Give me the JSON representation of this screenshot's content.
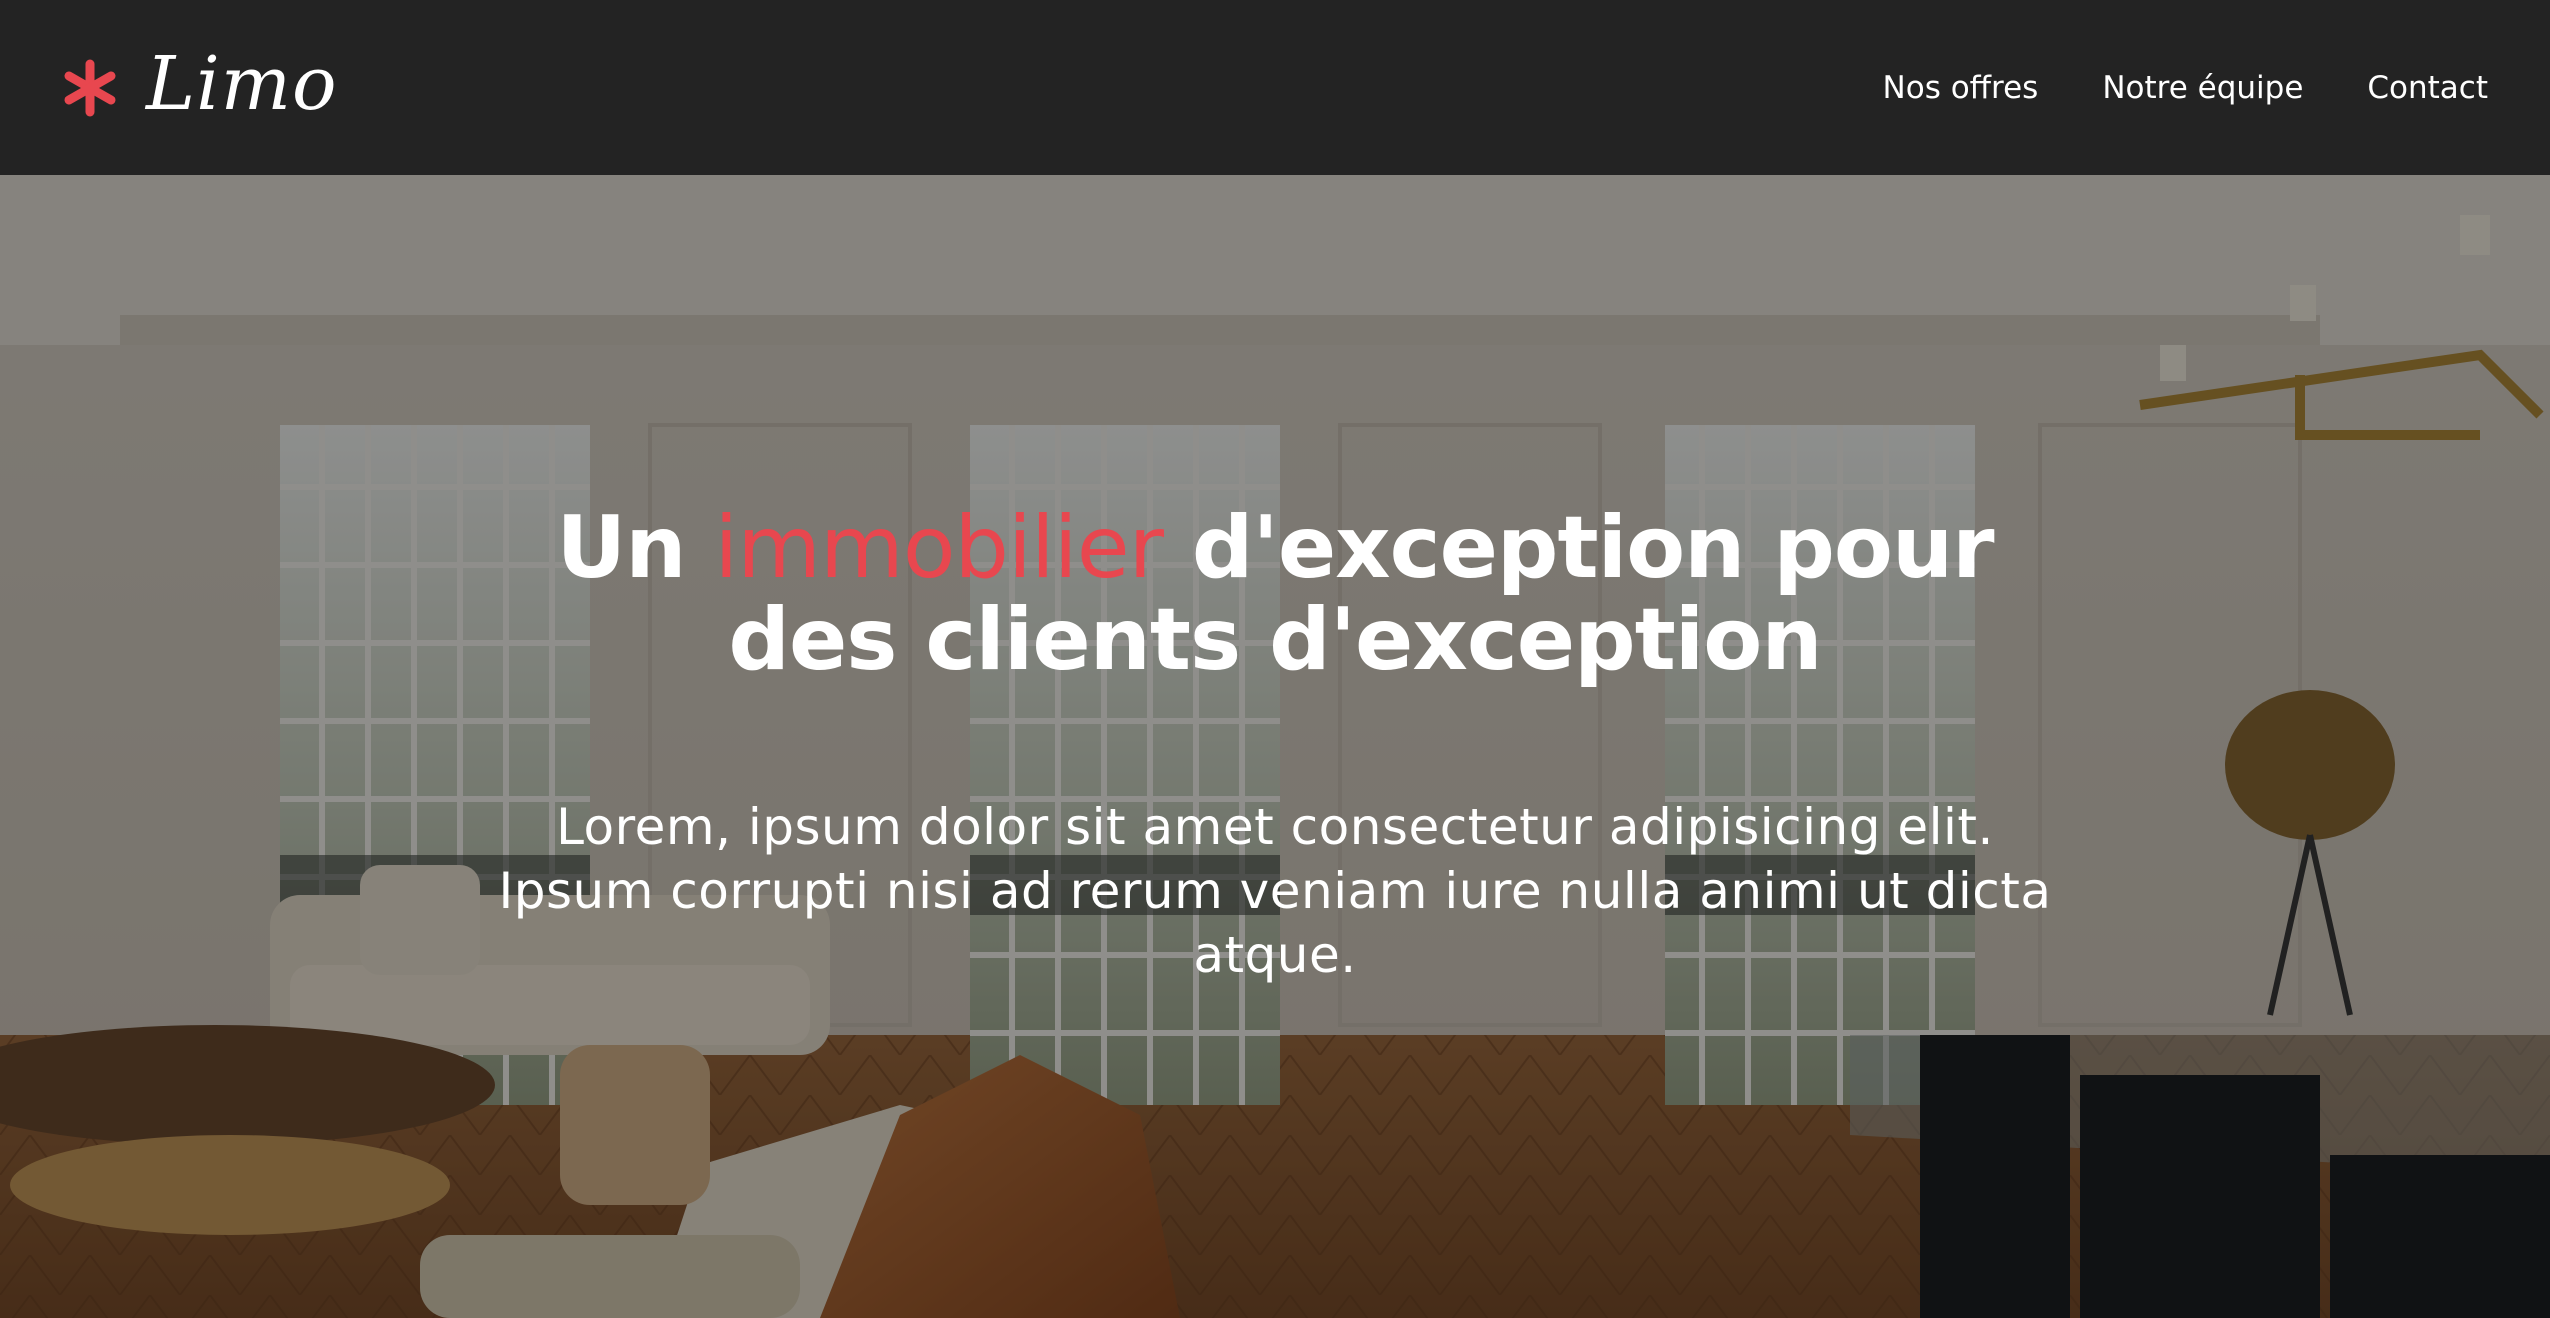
{
  "brand": {
    "name": "Limo",
    "star_color": "#e8474f",
    "logo_icon": "asterisk-icon"
  },
  "nav": {
    "items": [
      {
        "label": "Nos offres"
      },
      {
        "label": "Notre équipe"
      },
      {
        "label": "Contact"
      }
    ]
  },
  "hero": {
    "title_before": "Un ",
    "title_accent": "immobilier",
    "title_after": " d'exception pour des clients d'exception",
    "accent_color": "#e8474f",
    "text": "Lorem, ipsum dolor sit amet consectetur adipisicing elit. Ipsum corrupti nisi ad rerum veniam iure nulla animi ut dicta atque.",
    "background": "living-room-photo"
  }
}
